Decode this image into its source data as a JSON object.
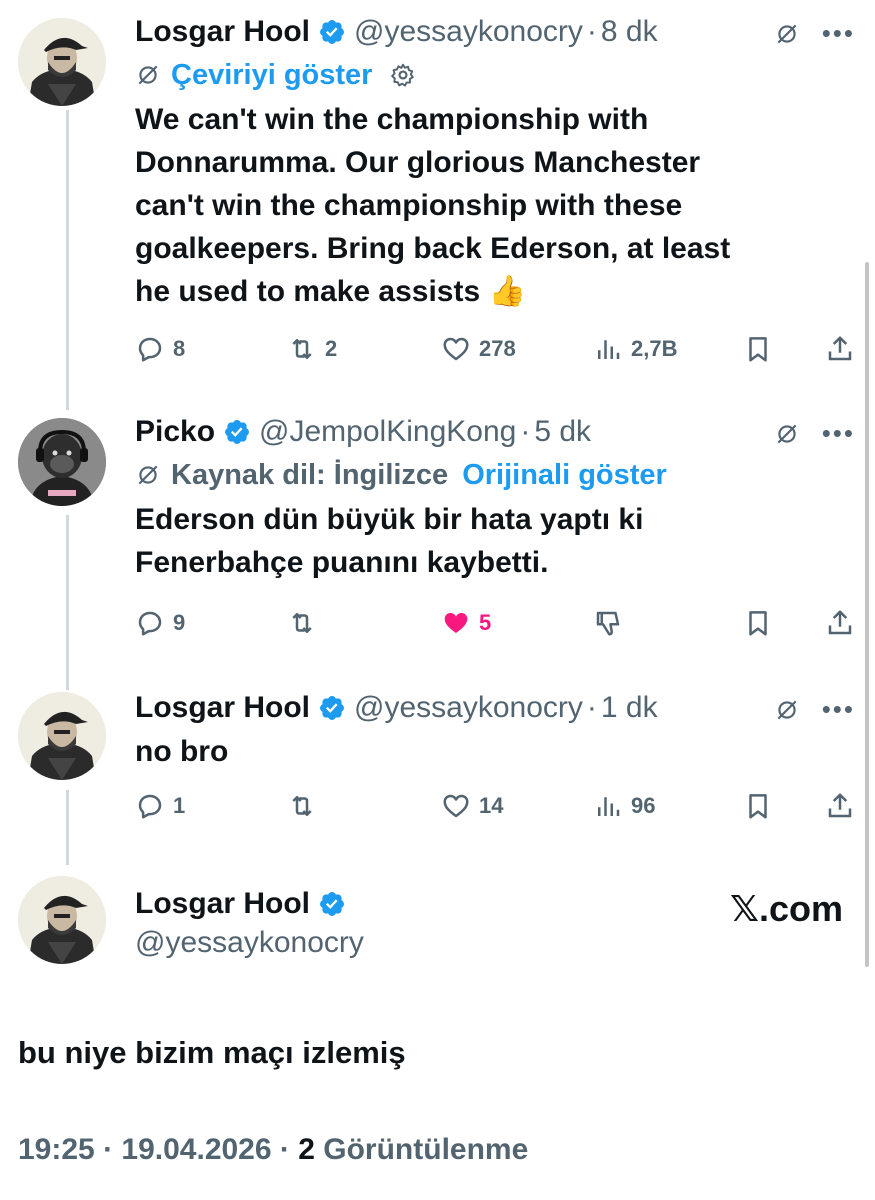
{
  "tweets": [
    {
      "name": "Losgar Hool",
      "handle": "@yessaykonocry",
      "time": "8 dk",
      "translation_link": "Çeviriyi göster",
      "text_lines": [
        "We can't win the championship with",
        "Donnarumma. Our glorious Manchester",
        "can't win the championship with these",
        "goalkeepers. Bring back Ederson, at least",
        "he used to make assists 👍"
      ],
      "replies": "8",
      "retweets": "2",
      "likes": "278",
      "views": "2,7B"
    },
    {
      "name": "Picko",
      "handle": "@JempolKingKong",
      "time": "5 dk",
      "source_lang": "Kaynak dil: İngilizce",
      "original_link": "Orijinali göster",
      "text_lines": [
        "Ederson dün büyük bir hata yaptı ki",
        "Fenerbahçe puanını kaybetti."
      ],
      "replies": "9",
      "retweets": "",
      "likes": "5"
    },
    {
      "name": "Losgar Hool",
      "handle": "@yessaykonocry",
      "time": "1 dk",
      "text_lines": [
        "no bro"
      ],
      "replies": "1",
      "retweets": "",
      "likes": "14",
      "views": "96"
    }
  ],
  "main": {
    "name": "Losgar Hool",
    "handle": "@yessaykonocry",
    "site": "𝕏.com",
    "text": "bu niye bizim maçı izlemiş",
    "time": "19:25",
    "date": "19.04.2026",
    "views_count": "2",
    "views_label": "Görüntülenme"
  },
  "colors": {
    "accent": "#1d9bf0",
    "like": "#f91880",
    "muted": "#536471"
  }
}
